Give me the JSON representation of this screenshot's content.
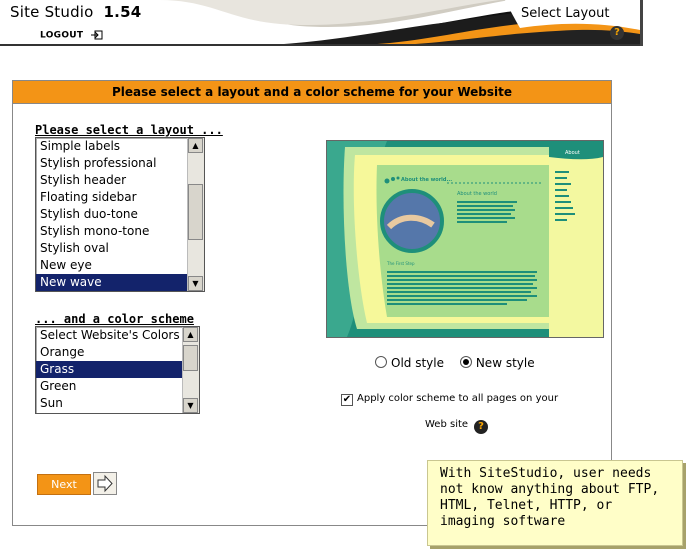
{
  "header": {
    "app_name": "Site Studio",
    "version": "1.54",
    "logout_label": "LOGOUT",
    "page_name": "Select Layout",
    "help_label": "?"
  },
  "panel": {
    "title": "Please select a layout and a color scheme for your Website",
    "layout_label": "Please select a layout ...",
    "layouts": [
      "Simple labels",
      "Stylish professional",
      "Stylish header",
      "Floating sidebar",
      "Stylish duo-tone",
      "Stylish mono-tone",
      "Stylish oval",
      "New eye",
      "New wave"
    ],
    "layout_selected": "New wave",
    "color_label": "... and a color scheme",
    "colors": [
      "Select Website's Colors",
      "Orange",
      "Grass",
      "Green",
      "Sun"
    ],
    "color_selected": "Grass",
    "style_options": {
      "old": "Old style",
      "new": "New style",
      "selected": "New style"
    },
    "apply_all_label": "Apply color scheme to all pages on your",
    "apply_all_label_2": "Web site",
    "apply_all_checked": true,
    "help_label": "?",
    "next_label": "Next"
  },
  "preview": {
    "tab_label": "About",
    "heading": "About the world...",
    "subheading": "About the world",
    "section": "The First Step",
    "nav_items": [
      "Home",
      "Links",
      "Web Map",
      "Games",
      "Survey",
      "Contact",
      "Directions",
      "FAQ content",
      "About"
    ]
  },
  "tip": {
    "text": "With SiteStudio, user needs not know anything about FTP, HTML, Telnet, HTTP, or imaging software"
  },
  "colors": {
    "accent_orange": "#f39416",
    "selection_navy": "#13236b",
    "tip_background": "#fffec8"
  }
}
